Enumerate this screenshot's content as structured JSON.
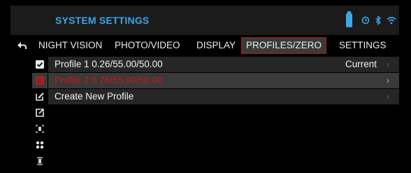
{
  "header": {
    "title": "SYSTEM SETTINGS",
    "status_icons": [
      "battery-icon",
      "timer-icon",
      "bluetooth-icon",
      "wifi-icon"
    ],
    "accent_color": "#3ca6e8"
  },
  "tabs": [
    {
      "label": "NIGHT VISION"
    },
    {
      "label": "PHOTO/VIDEO"
    },
    {
      "label": "DISPLAY"
    },
    {
      "label": "PROFILES/ZERO",
      "active": true
    },
    {
      "label": "SETTINGS"
    }
  ],
  "sidebar": {
    "icons": [
      "checkbox-checked-icon",
      "list-icon",
      "edit-icon",
      "export-icon",
      "target-icon",
      "dots-icon",
      "reticle-icon"
    ]
  },
  "profiles": {
    "rows": [
      {
        "label": "Profile 1 0.26/55.00/50.00",
        "value": "Current",
        "chevron": "›"
      },
      {
        "label": "Profile 2 0.26/55.00/50.00",
        "value": "",
        "chevron": "›"
      },
      {
        "label": "Create New Profile",
        "value": "",
        "chevron": "›"
      }
    ],
    "selected_color": "#c21818"
  }
}
